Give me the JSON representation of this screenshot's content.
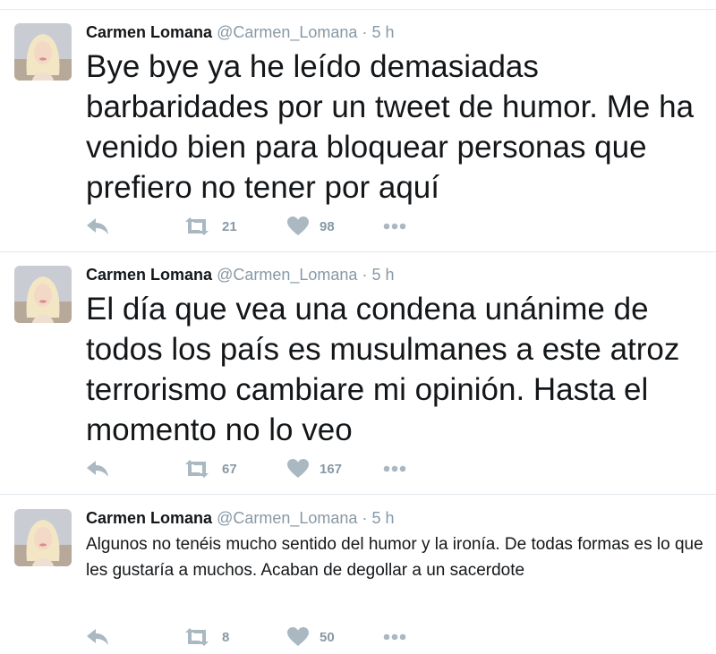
{
  "tweets": [
    {
      "name": "Carmen Lomana",
      "handle": "@Carmen_Lomana",
      "sep": "·",
      "time": "5 h",
      "text": "Bye bye ya he leído demasiadas barbaridades por un tweet de humor. Me ha venido bien para bloquear personas que prefiero no tener por aquí",
      "retweets": "21",
      "likes": "98"
    },
    {
      "name": "Carmen Lomana",
      "handle": "@Carmen_Lomana",
      "sep": "·",
      "time": "5 h",
      "text": "El día que vea una condena unánime de todos los país es musulmanes a este atroz terrorismo cambiare mi opinión. Hasta el momento no lo veo",
      "retweets": "67",
      "likes": "167"
    },
    {
      "name": "Carmen Lomana",
      "handle": "@Carmen_Lomana",
      "sep": "·",
      "time": "5 h",
      "text": "Algunos no tenéis mucho sentido del humor y la ironía. De todas formas es lo que les gustaría a muchos. Acaban de degollar a un sacerdote",
      "retweets": "8",
      "likes": "50"
    }
  ],
  "colors": {
    "text": "#14171a",
    "muted": "#8899a6",
    "icon": "#aab8c2",
    "divider": "#e1e8ed"
  },
  "icons": [
    "reply-icon",
    "retweet-icon",
    "heart-icon",
    "more-icon"
  ]
}
